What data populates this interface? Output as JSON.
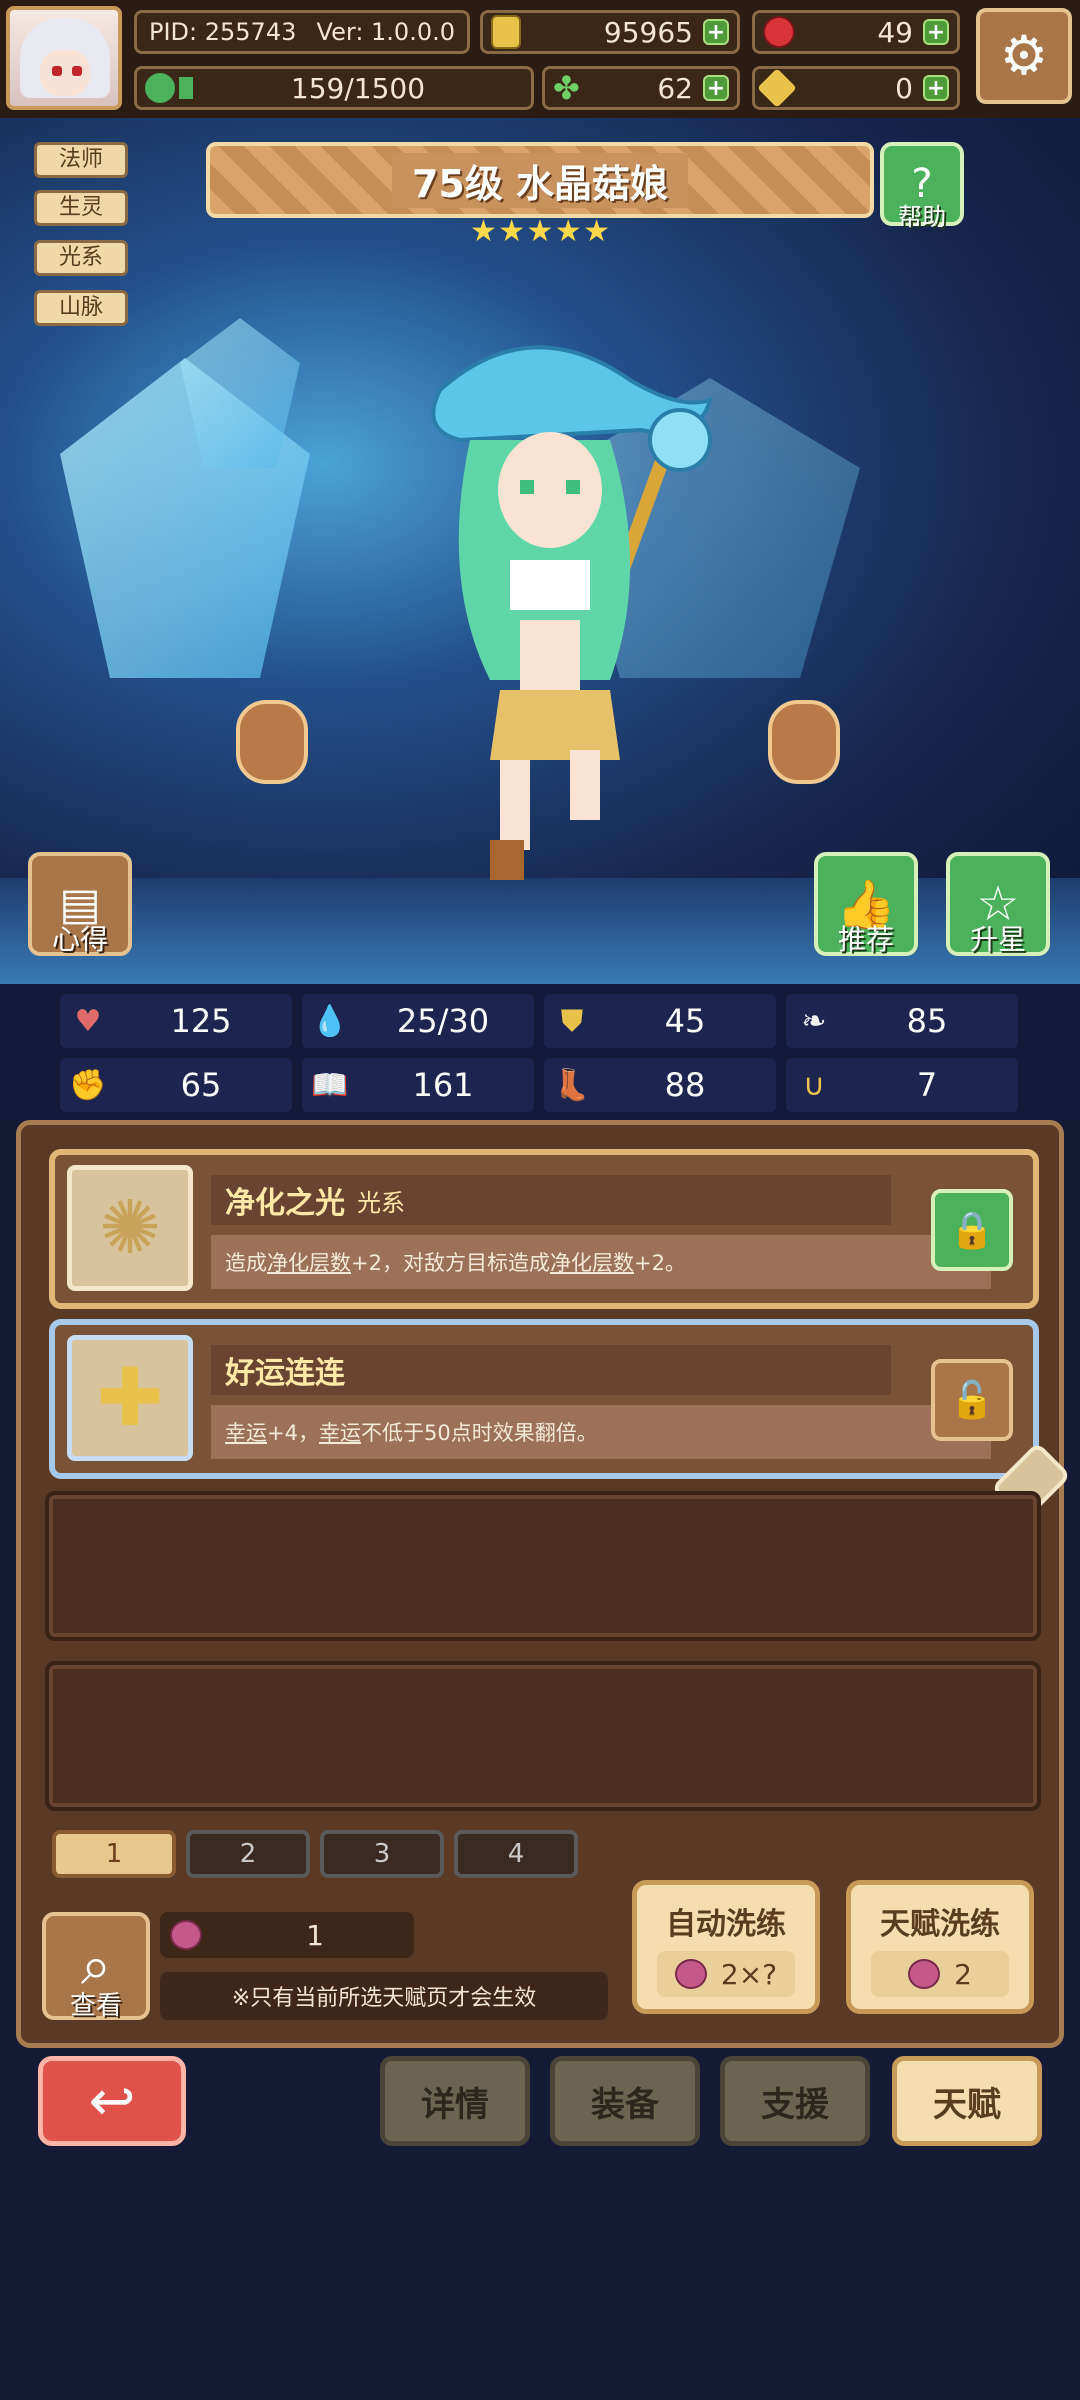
{
  "header": {
    "pid": "PID: 255743",
    "version": "Ver: 1.0.0.0",
    "gold": "95965",
    "gems": "49",
    "exp": "159/1500",
    "clover": "62",
    "keys": "0"
  },
  "tags": [
    "法师",
    "生灵",
    "光系",
    "山脉"
  ],
  "hero": {
    "title": "75级 水晶菇娘",
    "stars": 5,
    "help_label": "帮助",
    "notes_label": "心得",
    "recommend_label": "推荐",
    "upstar_label": "升星"
  },
  "stats": [
    {
      "icon": "heart-icon",
      "value": "125"
    },
    {
      "icon": "mana-drop-icon",
      "value": "25/30"
    },
    {
      "icon": "shield-icon",
      "value": "45"
    },
    {
      "icon": "wing-icon",
      "value": "85"
    },
    {
      "icon": "fist-icon",
      "value": "65"
    },
    {
      "icon": "book-icon",
      "value": "161"
    },
    {
      "icon": "boot-icon",
      "value": "88"
    },
    {
      "icon": "horseshoe-icon",
      "value": "7"
    }
  ],
  "talents": [
    {
      "name": "净化之光",
      "subtitle": "光系",
      "desc_parts": [
        "造成",
        "净化层数",
        "+2，对敌方目标造成",
        "净化层数",
        "+2。"
      ],
      "locked": true
    },
    {
      "name": "好运连连",
      "subtitle": "",
      "desc_parts": [
        "幸运",
        "+4，",
        "幸运",
        "不低于50点时效果翻倍。"
      ],
      "locked": false
    }
  ],
  "pages": [
    "1",
    "2",
    "3",
    "4"
  ],
  "controls": {
    "view_label": "查看",
    "berry_count": "1",
    "note": "※只有当前所选天赋页才会生效",
    "auto_reroll_label": "自动洗练",
    "auto_reroll_cost": "2×?",
    "talent_reroll_label": "天赋洗练",
    "talent_reroll_cost": "2"
  },
  "nav": {
    "details": "详情",
    "equipment": "装备",
    "support": "支援",
    "talent": "天赋"
  },
  "colors": {
    "accent_gold": "#e0b677",
    "button_green": "#4bb15a",
    "panel_brown": "#5b3a25",
    "back_red": "#e0514a"
  }
}
